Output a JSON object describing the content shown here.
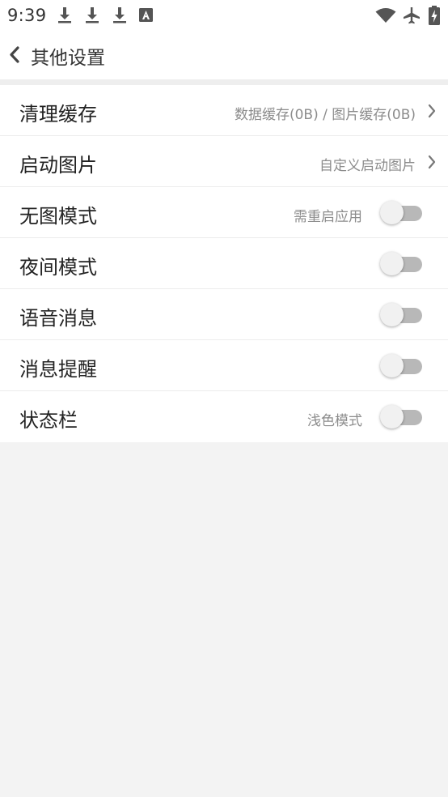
{
  "status_bar": {
    "time": "9:39",
    "icons": [
      "download-icon",
      "download-icon",
      "download-icon",
      "a-notification-icon",
      "wifi-icon",
      "airplane-icon",
      "battery-charging-icon"
    ]
  },
  "header": {
    "back_icon": "chevron-left-icon",
    "title": "其他设置"
  },
  "settings": {
    "clear_cache": {
      "label": "清理缓存",
      "value": "数据缓存(0B) / 图片缓存(0B)"
    },
    "splash_image": {
      "label": "启动图片",
      "value": "自定义启动图片"
    },
    "no_image_mode": {
      "label": "无图模式",
      "value": "需重启应用",
      "enabled": false
    },
    "night_mode": {
      "label": "夜间模式",
      "enabled": false
    },
    "voice_message": {
      "label": "语音消息",
      "enabled": false
    },
    "message_reminder": {
      "label": "消息提醒",
      "enabled": false
    },
    "status_bar_style": {
      "label": "状态栏",
      "value": "浅色模式",
      "enabled": false
    }
  },
  "colors": {
    "background": "#f3f3f3",
    "surface": "#ffffff",
    "toggle_track_off": "#b8b8b8",
    "secondary_text": "#8c8c8c"
  }
}
